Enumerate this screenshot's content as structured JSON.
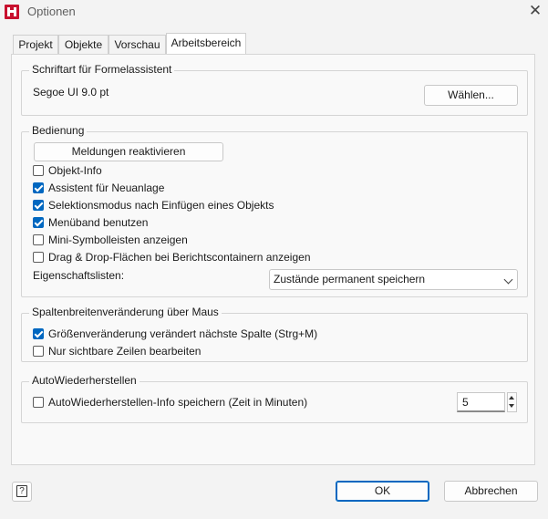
{
  "window": {
    "title": "Optionen",
    "app_icon": "report-designer-icon",
    "close_glyph": "✕"
  },
  "tabs": [
    {
      "label": "Projekt",
      "active": false
    },
    {
      "label": "Objekte",
      "active": false
    },
    {
      "label": "Vorschau",
      "active": false
    },
    {
      "label": "Arbeitsbereich",
      "active": true
    }
  ],
  "font_group": {
    "title": "Schriftart für Formelassistent",
    "font_value": "Segoe UI 9.0 pt",
    "choose_button": "Wählen..."
  },
  "operation_group": {
    "title": "Bedienung",
    "reactivate_button": "Meldungen reaktivieren",
    "checkboxes": [
      {
        "label": "Objekt-Info",
        "checked": false
      },
      {
        "label": "Assistent für Neuanlage",
        "checked": true
      },
      {
        "label": "Selektionsmodus nach Einfügen eines Objekts",
        "checked": true
      },
      {
        "label": "Menüband benutzen",
        "checked": true
      },
      {
        "label": "Mini-Symbolleisten anzeigen",
        "checked": false
      },
      {
        "label": "Drag & Drop-Flächen bei Berichtscontainern anzeigen",
        "checked": false
      }
    ],
    "property_lists_label": "Eigenschaftslisten:",
    "property_lists_value": "Zustände permanent speichern"
  },
  "column_group": {
    "title": "Spaltenbreitenveränderung über Maus",
    "checkboxes": [
      {
        "label": "Größenveränderung verändert nächste Spalte (Strg+M)",
        "checked": true
      },
      {
        "label": "Nur sichtbare Zeilen bearbeiten",
        "checked": false
      }
    ]
  },
  "autorestore_group": {
    "title": "AutoWiederherstellen",
    "checkbox": {
      "label": "AutoWiederherstellen-Info speichern (Zeit in Minuten)",
      "checked": false
    },
    "minutes_value": "5"
  },
  "footer": {
    "help_glyph": "?",
    "ok_label": "OK",
    "cancel_label": "Abbrechen"
  },
  "colors": {
    "accent": "#0067c0",
    "window_bg": "#f3f3f3",
    "panel_bg": "#f9f9f9"
  }
}
